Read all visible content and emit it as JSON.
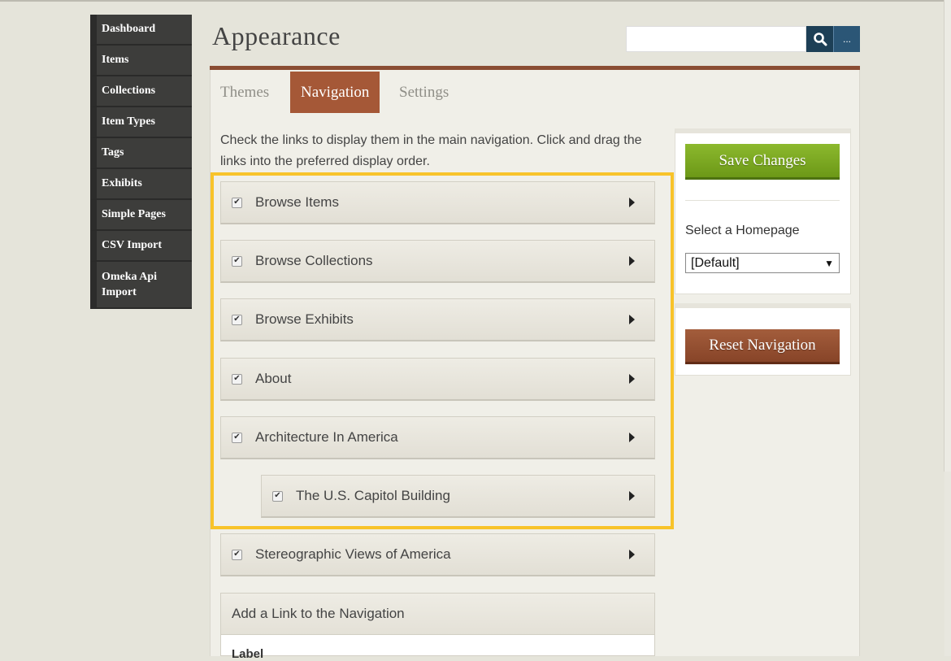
{
  "sidebar": {
    "items": [
      {
        "label": "Dashboard"
      },
      {
        "label": "Items"
      },
      {
        "label": "Collections"
      },
      {
        "label": "Item Types"
      },
      {
        "label": "Tags"
      },
      {
        "label": "Exhibits"
      },
      {
        "label": "Simple Pages"
      },
      {
        "label": "CSV Import"
      },
      {
        "label": "Omeka Api Import"
      }
    ]
  },
  "header": {
    "title": "Appearance",
    "search_value": "",
    "advanced_label": "..."
  },
  "tabs": [
    {
      "label": "Themes",
      "active": false
    },
    {
      "label": "Navigation",
      "active": true
    },
    {
      "label": "Settings",
      "active": false
    }
  ],
  "main": {
    "instructions": "Check the links to display them in the main navigation. Click and drag the links into the preferred display order.",
    "nav_links": [
      {
        "label": "Browse Items",
        "checked": true
      },
      {
        "label": "Browse Collections",
        "checked": true
      },
      {
        "label": "Browse Exhibits",
        "checked": true
      },
      {
        "label": "About",
        "checked": true
      },
      {
        "label": "Architecture In America",
        "checked": true
      },
      {
        "label": "The U.S. Capitol Building",
        "checked": true,
        "nested": true
      },
      {
        "label": "Stereographic Views of America",
        "checked": true
      }
    ],
    "add_link": {
      "heading": "Add a Link to the Navigation",
      "label_field": "Label"
    }
  },
  "aside": {
    "save_label": "Save Changes",
    "homepage_label": "Select a Homepage",
    "homepage_value": "[Default]",
    "reset_label": "Reset Navigation"
  },
  "colors": {
    "accent": "#a55837",
    "save_green": "#7aa823",
    "highlight": "#f8c32a",
    "search_blue": "#1d3f56"
  }
}
